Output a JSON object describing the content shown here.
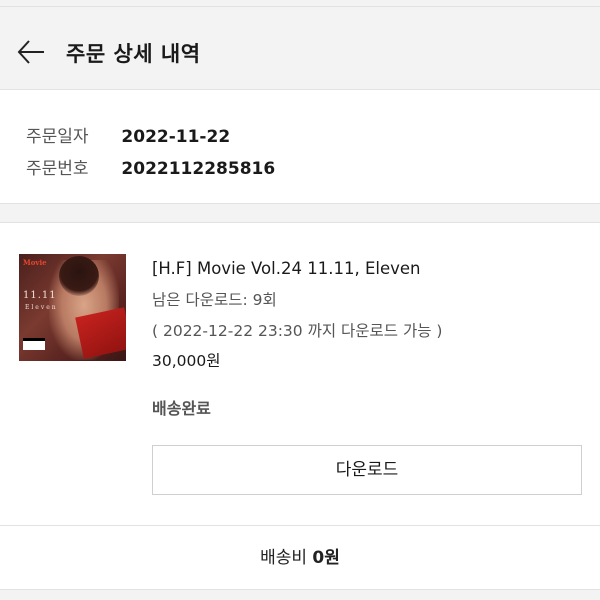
{
  "header": {
    "title": "주문 상세 내역",
    "back_icon": "arrow-left-icon"
  },
  "order_info": {
    "date_label": "주문일자",
    "date_value": "2022-11-22",
    "number_label": "주문번호",
    "number_value": "2022112285816"
  },
  "item": {
    "album_art": {
      "brand": "Movie",
      "vol_text": "11.11",
      "sub_text": "Eleven"
    },
    "name": "[H.F] Movie Vol.24 11.11, Eleven",
    "remaining_downloads": "남은 다운로드: 9회",
    "deadline": "( 2022-12-22 23:30 까지 다운로드 가능 )",
    "price": "30,000원",
    "status": "배송완료",
    "download_button_label": "다운로드"
  },
  "shipping": {
    "label": "배송비",
    "value": "0원"
  },
  "colors": {
    "background": "#f3f3f3",
    "card": "#ffffff",
    "border": "#e2e2e2",
    "text": "#1a1a1a",
    "muted": "#555555"
  }
}
